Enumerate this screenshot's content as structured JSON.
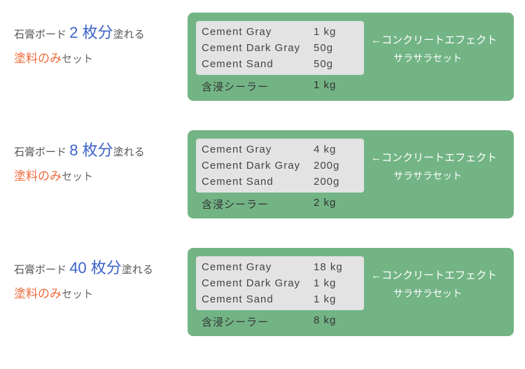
{
  "labelPrefix": "石膏ボード",
  "labelSuffix": "塗れる",
  "paintOnly": "塗料のみ",
  "setText": "セット",
  "sheetUnit": " 枚分",
  "arrowLabel": "←コンクリートエフェクト",
  "subLabel": "サラサラセット",
  "sealerName": "含浸シーラー",
  "products": [
    {
      "count": "2",
      "ingredients": [
        {
          "name": "Cement Gray",
          "amount": "1 kg"
        },
        {
          "name": "Cement Dark Gray",
          "amount": "50g"
        },
        {
          "name": "Cement Sand",
          "amount": "50g"
        }
      ],
      "sealerAmount": "1 kg"
    },
    {
      "count": "8",
      "ingredients": [
        {
          "name": "Cement Gray",
          "amount": "4 kg"
        },
        {
          "name": "Cement Dark Gray",
          "amount": "200g"
        },
        {
          "name": "Cement Sand",
          "amount": "200g"
        }
      ],
      "sealerAmount": "2 kg"
    },
    {
      "count": "40",
      "ingredients": [
        {
          "name": "Cement Gray",
          "amount": "18 kg"
        },
        {
          "name": "Cement Dark Gray",
          "amount": "1 kg"
        },
        {
          "name": "Cement Sand",
          "amount": "1 kg"
        }
      ],
      "sealerAmount": "8 kg"
    }
  ]
}
